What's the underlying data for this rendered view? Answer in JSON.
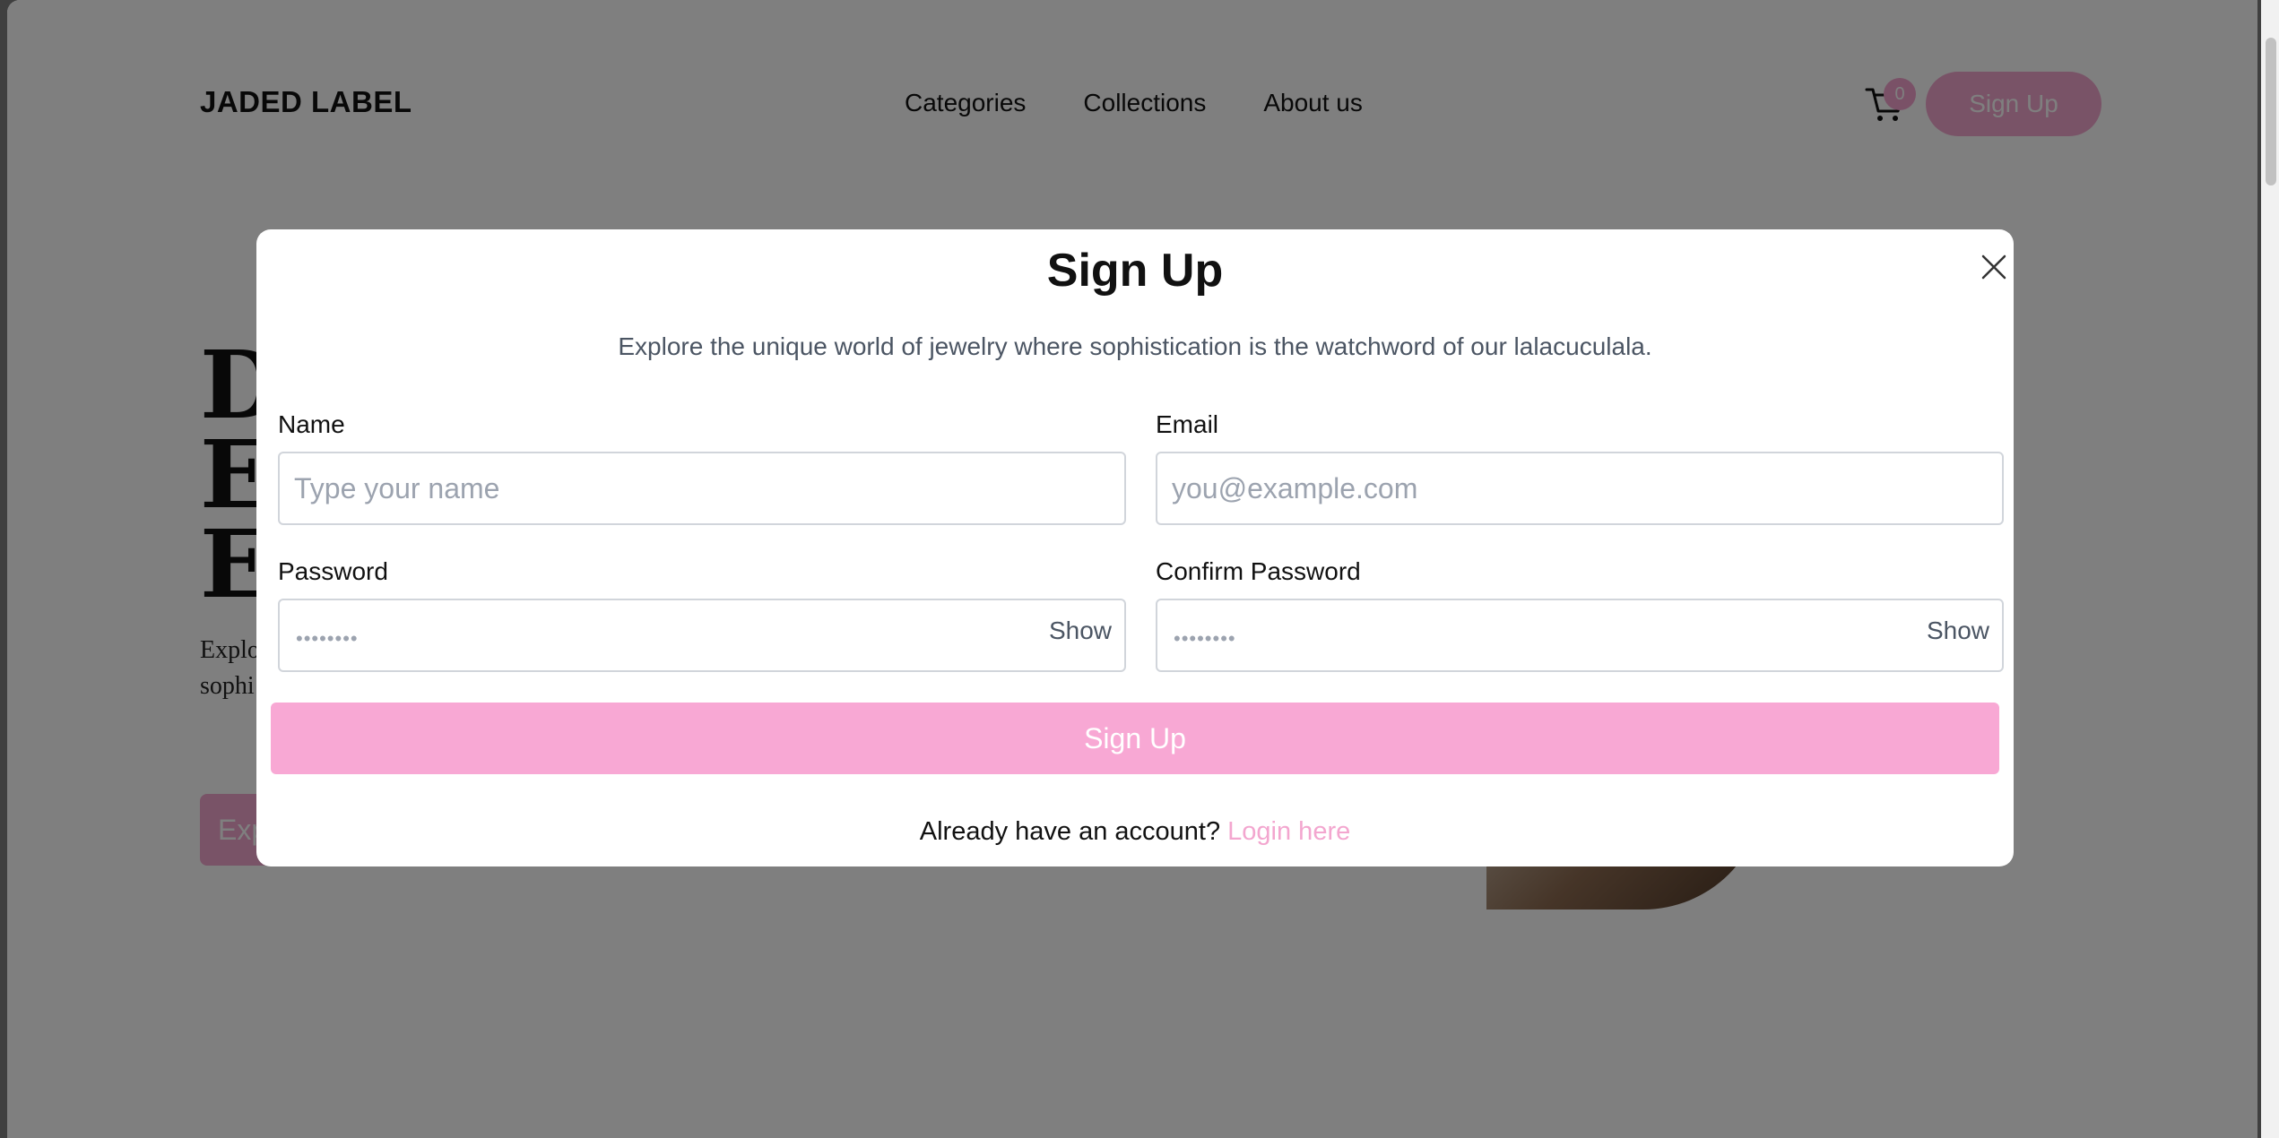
{
  "nav": {
    "logo": "JADED LABEL",
    "links": [
      "Categories",
      "Collections",
      "About us"
    ],
    "cart_count": "0",
    "signup_label": "Sign Up"
  },
  "hero": {
    "title_fragment": "D\nE\nE",
    "subtitle_fragment": "Explo\nsophi",
    "button_fragment": "Exp"
  },
  "modal": {
    "title": "Sign Up",
    "subtitle": "Explore the unique world of jewelry where sophistication is the watchword of our lalacuculala.",
    "fields": {
      "name": {
        "label": "Name",
        "placeholder": "Type your name"
      },
      "email": {
        "label": "Email",
        "placeholder": "you@example.com"
      },
      "password": {
        "label": "Password",
        "value_mask": "••••••••",
        "toggle": "Show"
      },
      "confirm_password": {
        "label": "Confirm Password",
        "value_mask": "••••••••",
        "toggle": "Show"
      }
    },
    "submit_label": "Sign Up",
    "footer_text": "Already have an account?",
    "login_link": "Login here"
  },
  "colors": {
    "accent_pink": "#f3a6cf",
    "overlay": "rgba(0,0,0,0.5)",
    "subtitle_gray": "#4b5563"
  },
  "icons": {
    "cart": "shopping-cart-icon",
    "close": "close-icon"
  }
}
